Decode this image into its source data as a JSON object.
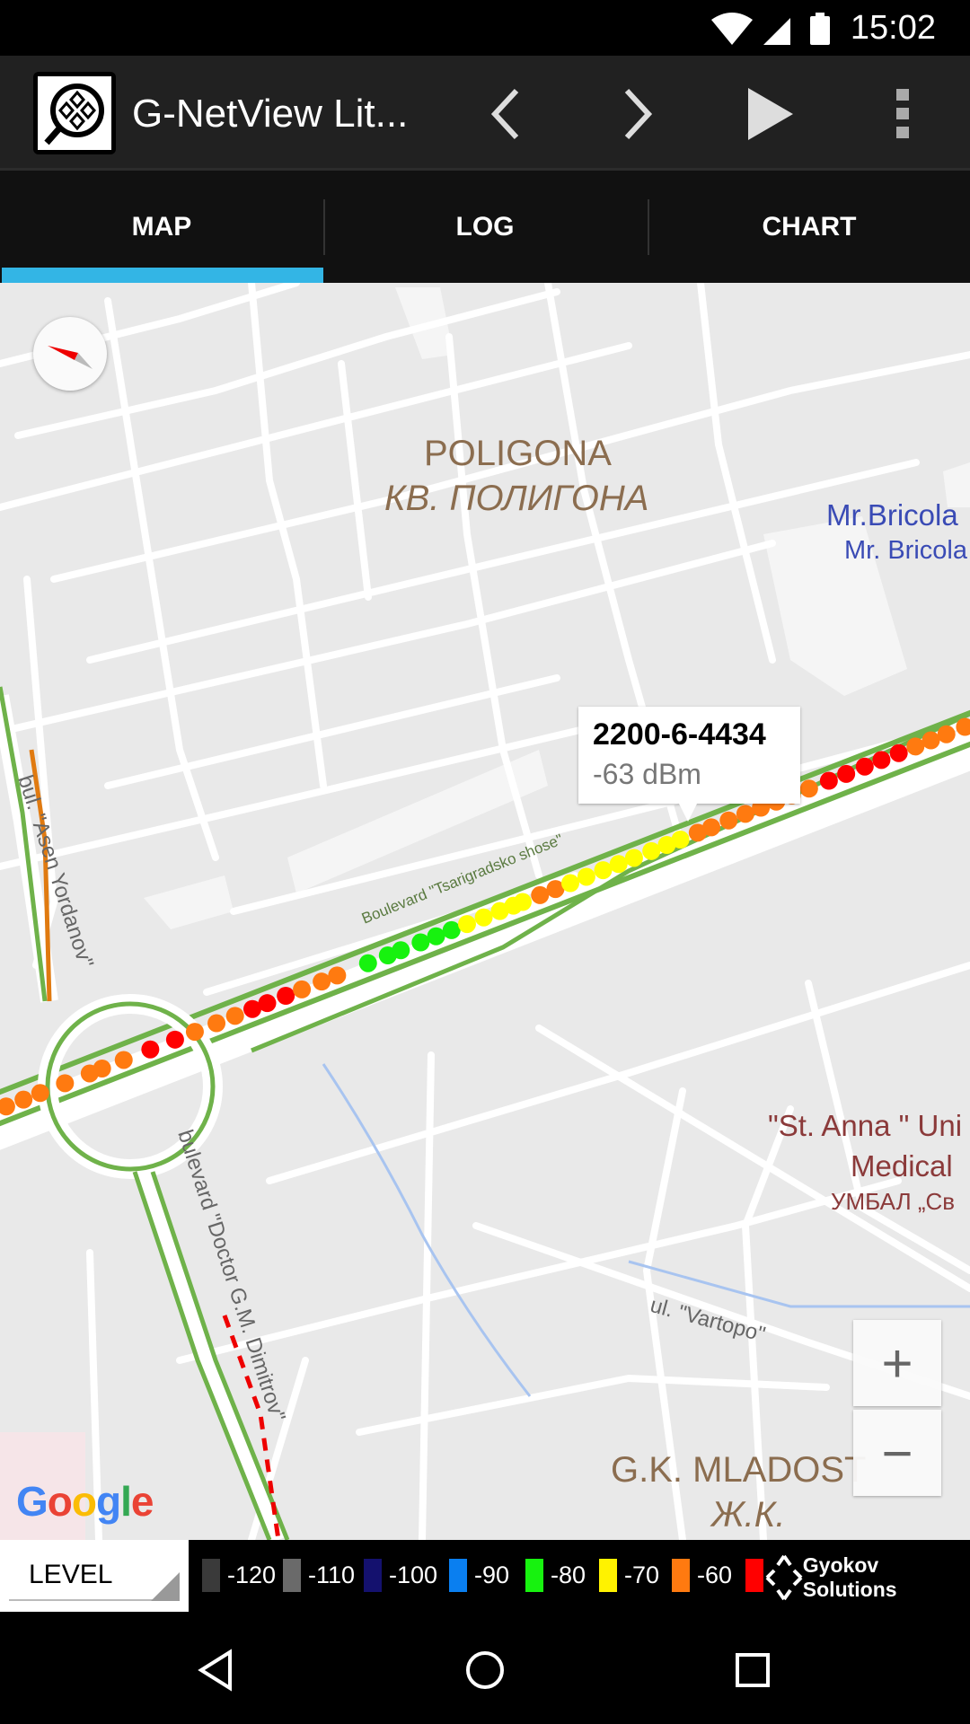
{
  "status_bar": {
    "time": "15:02",
    "icons": [
      "wifi-icon",
      "cell-signal-icon",
      "battery-icon"
    ]
  },
  "toolbar": {
    "title": "G-NetView Lit...",
    "icons": [
      "app-logo-icon",
      "chevron-left-icon",
      "chevron-right-icon",
      "play-icon",
      "overflow-menu-icon"
    ]
  },
  "tabs": [
    {
      "label": "MAP",
      "active": true
    },
    {
      "label": "LOG",
      "active": false
    },
    {
      "label": "CHART",
      "active": false
    }
  ],
  "map": {
    "labels": {
      "district": "POLIGONA",
      "district_cyr": "КВ. ПОЛИГОНА",
      "store1": "Mr.Bricola",
      "store2": "Mr. Bricola",
      "street_boulevard": "Boulevard \"Tsarigradsko shose\"",
      "street_asen": "bul. \"Asen Yordanov\"",
      "street_dimitrov": "bulevard \"Doctor G.M. Dimitrov\"",
      "hospital1": "\"St. Anna \" Uni",
      "hospital2": "Medical",
      "hospital3": "УМБАЛ „Св",
      "street_vartopo": "ul. \"Vartopo\"",
      "mladost": "G.K. MLADOST",
      "mladost_cyr": "Ж.К.",
      "google": "Google"
    },
    "tooltip": {
      "cell_id": "2200-6-4434",
      "signal": "-63 dBm"
    },
    "zoom_in": "+",
    "zoom_out": "−",
    "track_colors": [
      "O",
      "O",
      "O",
      "O",
      "O",
      "O",
      "O",
      "R",
      "R",
      "O",
      "O",
      "O",
      "R",
      "R",
      "R",
      "O",
      "O",
      "O",
      "G",
      "G",
      "G",
      "G",
      "G",
      "G",
      "Y",
      "Y",
      "Y",
      "Y",
      "Y",
      "O",
      "O",
      "Y",
      "Y",
      "Y",
      "Y",
      "Y",
      "Y",
      "Y",
      "Y",
      "O",
      "O",
      "O",
      "O",
      "O",
      "O",
      "O",
      "O",
      "R",
      "R",
      "R",
      "R",
      "R",
      "O",
      "O",
      "O",
      "O"
    ]
  },
  "legend": {
    "selector": "LEVEL",
    "items": [
      {
        "label": "-120",
        "color": "#3a3a3a"
      },
      {
        "label": "-110",
        "color": "#6a6a6a"
      },
      {
        "label": "-100",
        "color": "#14116e"
      },
      {
        "label": "-90",
        "color": "#0a7ff0"
      },
      {
        "label": "-80",
        "color": "#17f20f"
      },
      {
        "label": "-70",
        "color": "#fff200"
      },
      {
        "label": "-60",
        "color": "#ff7a10"
      },
      {
        "label": "",
        "color": "#ff0000"
      }
    ],
    "brand": "Gyokov Solutions"
  },
  "colors": {
    "accent": "#33b5e5",
    "road_green": "#6fb24a",
    "O": "#ff7a10",
    "R": "#ff0000",
    "Y": "#ffff00",
    "G": "#17f20f"
  }
}
